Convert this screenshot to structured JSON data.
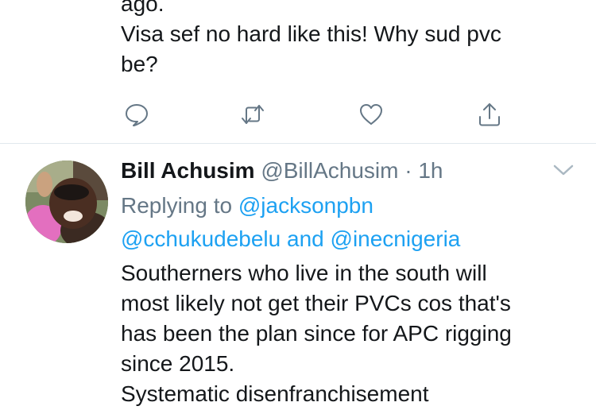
{
  "previous_tweet": {
    "lines": [
      "ago.",
      "Visa sef no hard like this! Why sud pvc",
      "be?"
    ]
  },
  "actions": [
    {
      "icon": "reply-icon"
    },
    {
      "icon": "retweet-icon"
    },
    {
      "icon": "like-icon"
    },
    {
      "icon": "share-icon"
    }
  ],
  "tweet": {
    "name": "Bill Achusim",
    "handle": "@BillAchusim",
    "separator": "·",
    "time": "1h",
    "replying_label": "Replying to",
    "mention_1": "@jacksonpbn",
    "mention_2": "@cchukudebelu",
    "and_label": "and",
    "mention_3": "@inecnigeria",
    "lines": [
      "Southerners who live in the south will",
      "most likely not get their PVCs cos that's",
      "has been the plan since for APC rigging",
      "since 2015.",
      "Systematic disenfranchisement"
    ]
  },
  "colors": {
    "link": "#1da1f2",
    "secondary": "#657786",
    "text": "#14171a",
    "divider": "#e1e8ed"
  }
}
